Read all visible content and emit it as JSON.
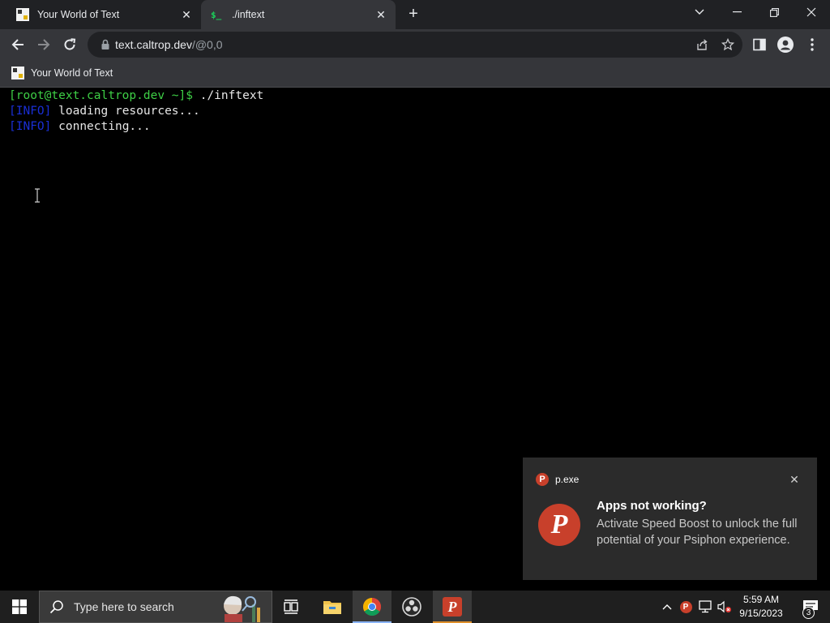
{
  "browser": {
    "tabs": [
      {
        "title": "Your World of Text",
        "favicon": "ywot-favicon-icon",
        "active": false
      },
      {
        "title": "./inftext",
        "favicon": "terminal-favicon-icon",
        "favicon_text": "$_",
        "active": true
      }
    ],
    "omnibox": {
      "host": "text.caltrop.dev",
      "path": "/@0,0"
    },
    "bookmarks": [
      {
        "label": "Your World of Text"
      }
    ]
  },
  "terminal": {
    "prompt": "[root@text.caltrop.dev ~]$",
    "command": "./inftext",
    "lines": [
      {
        "tag": "[INFO]",
        "text": "loading resources..."
      },
      {
        "tag": "[INFO]",
        "text": "connecting..."
      }
    ],
    "colors": {
      "prompt": "#3ecf46",
      "info_tag": "#1a2fd6",
      "text": "#e6e6e6",
      "background": "#000000"
    }
  },
  "toast": {
    "app_name": "p.exe",
    "logo_letter": "P",
    "title": "Apps not working?",
    "body": "Activate Speed Boost to unlock the full potential of your Psiphon experience."
  },
  "taskbar": {
    "search_placeholder": "Type here to search",
    "apps": [
      {
        "name": "task-view-icon"
      },
      {
        "name": "file-explorer-icon"
      },
      {
        "name": "chrome-icon"
      },
      {
        "name": "obs-icon"
      },
      {
        "name": "psiphon-icon",
        "letter": "P"
      }
    ],
    "clock": {
      "time": "5:59 AM",
      "date": "9/15/2023"
    },
    "notification_count": "3"
  }
}
